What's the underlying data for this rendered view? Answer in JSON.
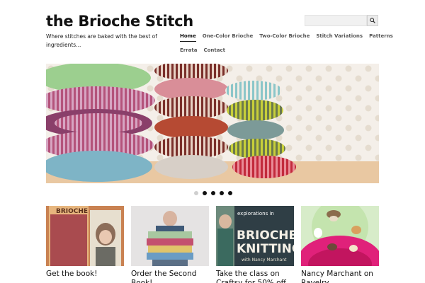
{
  "site": {
    "title": "the Brioche Stitch",
    "tagline": "Where stitches are baked with the best of ingredients..."
  },
  "search": {
    "placeholder": "",
    "value": "",
    "icon": "search-icon"
  },
  "nav": {
    "row1": [
      "Home",
      "One-Color Brioche",
      "Two-Color Brioche",
      "Stitch Variations",
      "Patterns"
    ],
    "row2": [
      "Errata",
      "Contact"
    ],
    "active": "Home"
  },
  "slider": {
    "slide_count": 5,
    "active_slide": 1
  },
  "cards": [
    {
      "title": "Get the book!",
      "image_text": "BRIOCHE"
    },
    {
      "title": "Order the Second Book!",
      "image_text": ""
    },
    {
      "title": "Take the class on Craftsy for 50% off",
      "image_text": "explorations in BRIOCHE KNITTING with Nancy Marchant"
    },
    {
      "title": "Nancy Marchant on Ravelry",
      "image_text": ""
    }
  ],
  "colors": {
    "text": "#111111",
    "nav_inactive": "#555555",
    "dot_active": "#111111",
    "dot_inactive": "#cfcfcf"
  }
}
